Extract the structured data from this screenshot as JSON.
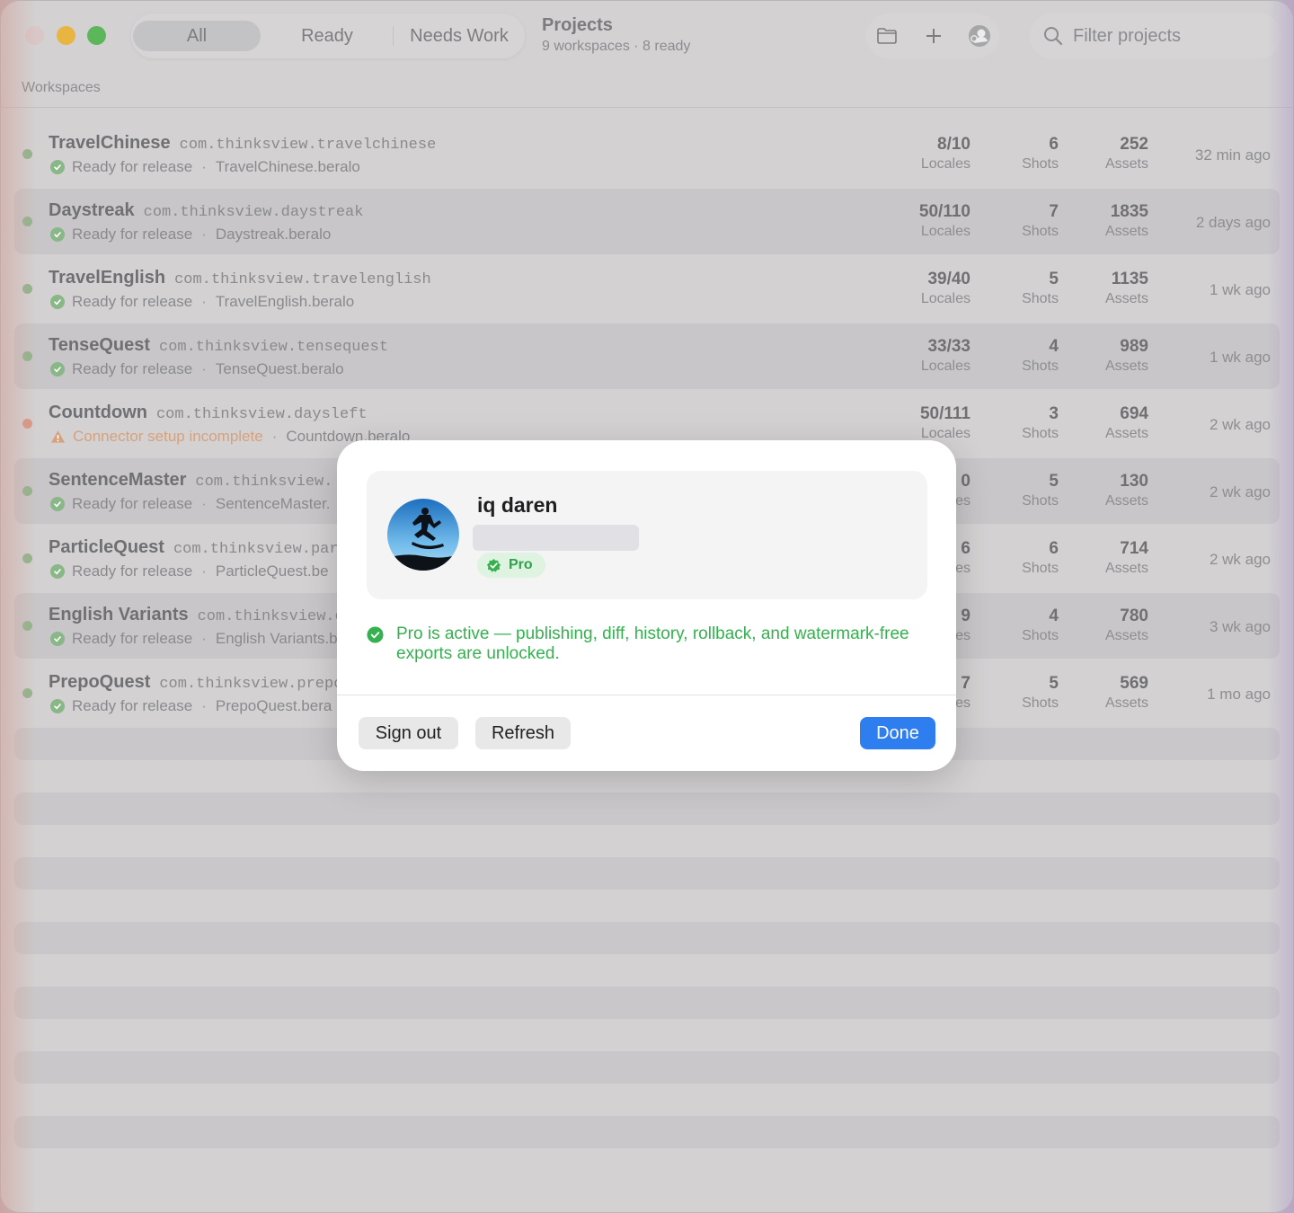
{
  "toolbar": {
    "tabs": [
      {
        "label": "All",
        "active": true
      },
      {
        "label": "Ready",
        "active": false
      },
      {
        "label": "Needs Work",
        "active": false
      }
    ],
    "title": "Projects",
    "subtitle": "9 workspaces · 8 ready",
    "icons": [
      "folder-icon",
      "plus-icon",
      "account-icon"
    ],
    "search": {
      "placeholder": "Filter projects",
      "value": ""
    }
  },
  "section_label": "Workspaces",
  "rows": [
    {
      "name": "TravelChinese",
      "bundle": "com.thinksview.travelchinese",
      "status": "Ready for release",
      "status_type": "ok",
      "file": "TravelChinese.beralo",
      "locales": "8/10",
      "locales_label": "Locales",
      "shots": "6",
      "shots_label": "Shots",
      "assets": "252",
      "assets_label": "Assets",
      "time": "32 min ago"
    },
    {
      "name": "Daystreak",
      "bundle": "com.thinksview.daystreak",
      "status": "Ready for release",
      "status_type": "ok",
      "file": "Daystreak.beralo",
      "locales": "50/110",
      "locales_label": "Locales",
      "shots": "7",
      "shots_label": "Shots",
      "assets": "1835",
      "assets_label": "Assets",
      "time": "2 days ago"
    },
    {
      "name": "TravelEnglish",
      "bundle": "com.thinksview.travelenglish",
      "status": "Ready for release",
      "status_type": "ok",
      "file": "TravelEnglish.beralo",
      "locales": "39/40",
      "locales_label": "Locales",
      "shots": "5",
      "shots_label": "Shots",
      "assets": "1135",
      "assets_label": "Assets",
      "time": "1 wk ago"
    },
    {
      "name": "TenseQuest",
      "bundle": "com.thinksview.tensequest",
      "status": "Ready for release",
      "status_type": "ok",
      "file": "TenseQuest.beralo",
      "locales": "33/33",
      "locales_label": "Locales",
      "shots": "4",
      "shots_label": "Shots",
      "assets": "989",
      "assets_label": "Assets",
      "time": "1 wk ago"
    },
    {
      "name": "Countdown",
      "bundle": "com.thinksview.daysleft",
      "status": "Connector setup incomplete",
      "status_type": "warn",
      "file": "Countdown.beralo",
      "locales": "50/111",
      "locales_label": "Locales",
      "shots": "3",
      "shots_label": "Shots",
      "assets": "694",
      "assets_label": "Assets",
      "time": "2 wk ago"
    },
    {
      "name": "SentenceMaster",
      "bundle": "com.thinksview.",
      "status": "Ready for release",
      "status_type": "ok",
      "file": "SentenceMaster.",
      "locales": "0",
      "locales_label": "es",
      "shots": "5",
      "shots_label": "Shots",
      "assets": "130",
      "assets_label": "Assets",
      "time": "2 wk ago"
    },
    {
      "name": "ParticleQuest",
      "bundle": "com.thinksview.par",
      "status": "Ready for release",
      "status_type": "ok",
      "file": "ParticleQuest.be",
      "locales": "6",
      "locales_label": "es",
      "shots": "6",
      "shots_label": "Shots",
      "assets": "714",
      "assets_label": "Assets",
      "time": "2 wk ago"
    },
    {
      "name": "English Variants",
      "bundle": "com.thinksview.e",
      "status": "Ready for release",
      "status_type": "ok",
      "file": "English Variants.b",
      "locales": "9",
      "locales_label": "es",
      "shots": "4",
      "shots_label": "Shots",
      "assets": "780",
      "assets_label": "Assets",
      "time": "3 wk ago"
    },
    {
      "name": "PrepoQuest",
      "bundle": "com.thinksview.prepo",
      "status": "Ready for release",
      "status_type": "ok",
      "file": "PrepoQuest.bera",
      "locales": "7",
      "locales_label": "es",
      "shots": "5",
      "shots_label": "Shots",
      "assets": "569",
      "assets_label": "Assets",
      "time": "1 mo ago"
    }
  ],
  "modal": {
    "user_name": "iq daren",
    "badge": "Pro",
    "message": "Pro is active — publishing, diff, history, rollback, and watermark-free exports are unlocked.",
    "buttons": {
      "sign_out": "Sign out",
      "refresh": "Refresh",
      "done": "Done"
    }
  },
  "colors": {
    "accent": "#2f7ef0",
    "success": "#35b14f",
    "warning": "#d5a27d"
  }
}
